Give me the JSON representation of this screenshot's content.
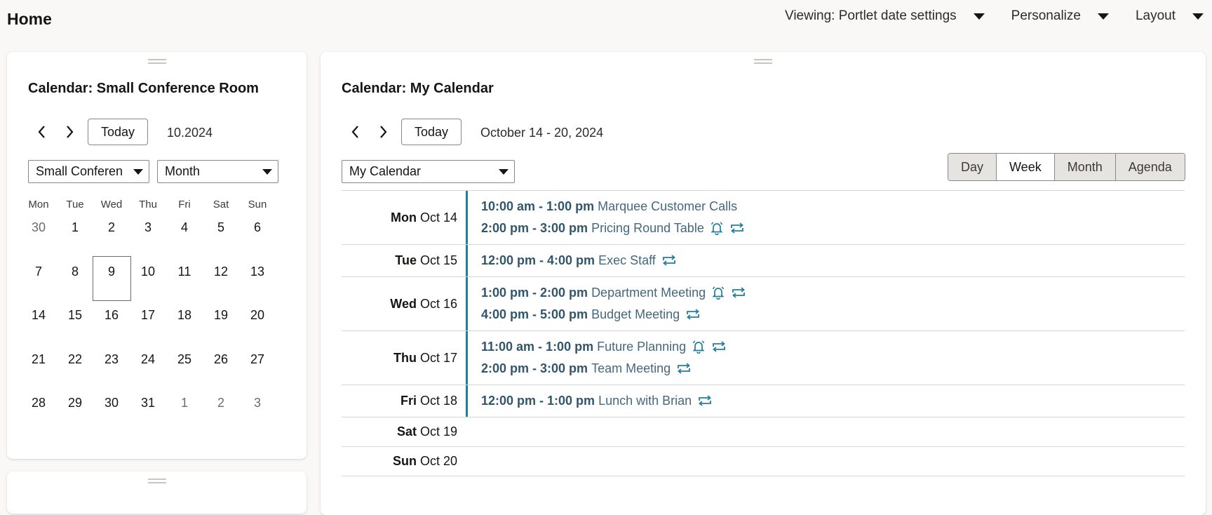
{
  "page": {
    "title": "Home"
  },
  "top_menus": [
    {
      "label": "Viewing: Portlet date settings"
    },
    {
      "label": "Personalize"
    },
    {
      "label": "Layout"
    }
  ],
  "small_calendar": {
    "title": "Calendar: Small Conference Room",
    "today_label": "Today",
    "period_label": "10.2024",
    "resource_select": "Small Conferen",
    "view_select": "Month",
    "weekdays": [
      "Mon",
      "Tue",
      "Wed",
      "Thu",
      "Fri",
      "Sat",
      "Sun"
    ],
    "days": [
      {
        "d": "30",
        "other": true
      },
      {
        "d": "1"
      },
      {
        "d": "2"
      },
      {
        "d": "3"
      },
      {
        "d": "4"
      },
      {
        "d": "5"
      },
      {
        "d": "6"
      },
      {
        "d": "7"
      },
      {
        "d": "8"
      },
      {
        "d": "9",
        "selected": true
      },
      {
        "d": "10"
      },
      {
        "d": "11"
      },
      {
        "d": "12"
      },
      {
        "d": "13"
      },
      {
        "d": "14"
      },
      {
        "d": "15"
      },
      {
        "d": "16"
      },
      {
        "d": "17"
      },
      {
        "d": "18"
      },
      {
        "d": "19"
      },
      {
        "d": "20"
      },
      {
        "d": "21"
      },
      {
        "d": "22"
      },
      {
        "d": "23"
      },
      {
        "d": "24"
      },
      {
        "d": "25"
      },
      {
        "d": "26"
      },
      {
        "d": "27"
      },
      {
        "d": "28"
      },
      {
        "d": "29"
      },
      {
        "d": "30"
      },
      {
        "d": "31"
      },
      {
        "d": "1",
        "other": true
      },
      {
        "d": "2",
        "other": true
      },
      {
        "d": "3",
        "other": true
      }
    ]
  },
  "my_calendar": {
    "title": "Calendar: My Calendar",
    "today_label": "Today",
    "range_label": "October 14 - 20, 2024",
    "calendar_select": "My Calendar",
    "views": [
      {
        "label": "Day",
        "active": false
      },
      {
        "label": "Week",
        "active": true
      },
      {
        "label": "Month",
        "active": false
      },
      {
        "label": "Agenda",
        "active": false
      }
    ],
    "days": [
      {
        "dow": "Mon",
        "date": "Oct 14",
        "events": [
          {
            "time": "10:00 am - 1:00 pm",
            "title": "Marquee Customer Calls",
            "alarm": false,
            "repeat": false
          },
          {
            "time": "2:00 pm - 3:00 pm",
            "title": "Pricing Round Table",
            "alarm": true,
            "repeat": true
          }
        ]
      },
      {
        "dow": "Tue",
        "date": "Oct 15",
        "events": [
          {
            "time": "12:00 pm - 4:00 pm",
            "title": "Exec Staff",
            "alarm": false,
            "repeat": true
          }
        ]
      },
      {
        "dow": "Wed",
        "date": "Oct 16",
        "events": [
          {
            "time": "1:00 pm - 2:00 pm",
            "title": "Department Meeting",
            "alarm": true,
            "repeat": true
          },
          {
            "time": "4:00 pm - 5:00 pm",
            "title": "Budget Meeting",
            "alarm": false,
            "repeat": true
          }
        ]
      },
      {
        "dow": "Thu",
        "date": "Oct 17",
        "events": [
          {
            "time": "11:00 am - 1:00 pm",
            "title": "Future Planning",
            "alarm": true,
            "repeat": true
          },
          {
            "time": "2:00 pm - 3:00 pm",
            "title": "Team Meeting",
            "alarm": false,
            "repeat": true
          }
        ]
      },
      {
        "dow": "Fri",
        "date": "Oct 18",
        "events": [
          {
            "time": "12:00 pm - 1:00 pm",
            "title": "Lunch with Brian",
            "alarm": false,
            "repeat": true
          }
        ]
      },
      {
        "dow": "Sat",
        "date": "Oct 19",
        "events": []
      },
      {
        "dow": "Sun",
        "date": "Oct 20",
        "events": []
      }
    ]
  },
  "icons": {
    "prev": "chevron-left-icon",
    "next": "chevron-right-icon",
    "alarm": "bell-icon",
    "repeat": "repeat-icon",
    "drag": "drag-handle-icon"
  },
  "colors": {
    "accent": "#227e9e",
    "event_text": "#44687f",
    "page_bg": "#f9f8f6"
  }
}
